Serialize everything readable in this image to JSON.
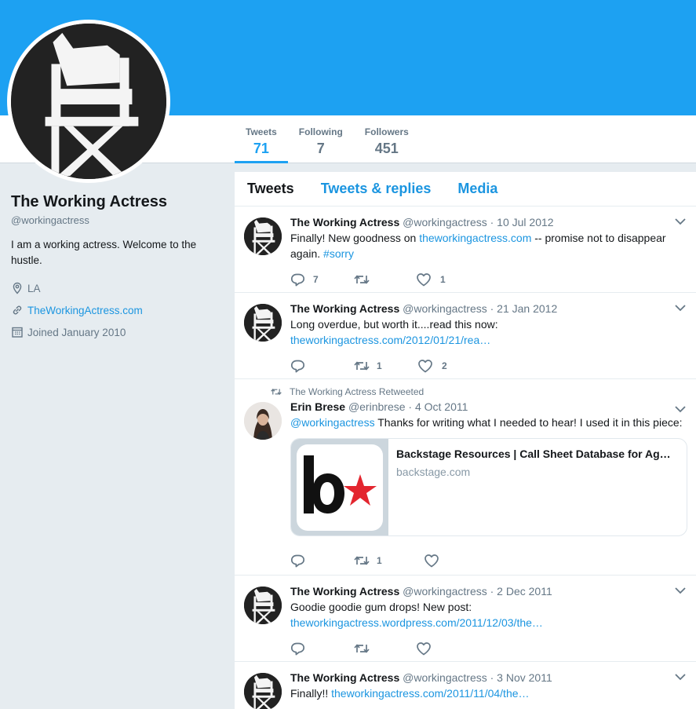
{
  "profile": {
    "name": "The Working Actress",
    "handle": "@workingactress",
    "bio": "I am a working actress. Welcome to the hustle.",
    "location": "LA",
    "website": "TheWorkingActress.com",
    "joined": "Joined January 2010"
  },
  "stats": [
    {
      "label": "Tweets",
      "value": "71"
    },
    {
      "label": "Following",
      "value": "7"
    },
    {
      "label": "Followers",
      "value": "451"
    }
  ],
  "tabs": [
    "Tweets",
    "Tweets & replies",
    "Media"
  ],
  "tweets": [
    {
      "name": "The Working Actress",
      "meta": "@workingactress · 10 Jul 2012",
      "pre": "Finally! New goodness on ",
      "link": "theworkingactress.com",
      "mid": " -- promise not to disappear again. ",
      "tag": "#sorry",
      "replies": "7",
      "retweets": "",
      "likes": "1"
    },
    {
      "name": "The Working Actress",
      "meta": "@workingactress · 21 Jan 2012",
      "line1": "Long overdue, but worth it....read this now:",
      "link": "theworkingactress.com/2012/01/21/rea…",
      "replies": "",
      "retweets": "1",
      "likes": "2"
    },
    {
      "context": "The Working Actress Retweeted",
      "name": "Erin Brese",
      "meta": "@erinbrese · 4 Oct 2011",
      "mention": "@workingactress",
      "text": " Thanks for writing what I needed to hear!  I used it in this piece:",
      "card_title": "Backstage Resources | Call Sheet Database for Ag…",
      "card_domain": "backstage.com",
      "replies": "",
      "retweets": "1",
      "likes": ""
    },
    {
      "name": "The Working Actress",
      "meta": "@workingactress · 2 Dec 2011",
      "line1": "Goodie goodie gum drops! New post:",
      "link": "theworkingactress.wordpress.com/2011/12/03/the…",
      "replies": "",
      "retweets": "",
      "likes": ""
    },
    {
      "name": "The Working Actress",
      "meta": "@workingactress · 3 Nov 2011",
      "pre": "Finally!! ",
      "link": "theworkingactress.com/2011/11/04/the…"
    }
  ],
  "colors": {
    "header": "#1da1f2",
    "link": "#1b95e0",
    "star": "#e3262f"
  }
}
